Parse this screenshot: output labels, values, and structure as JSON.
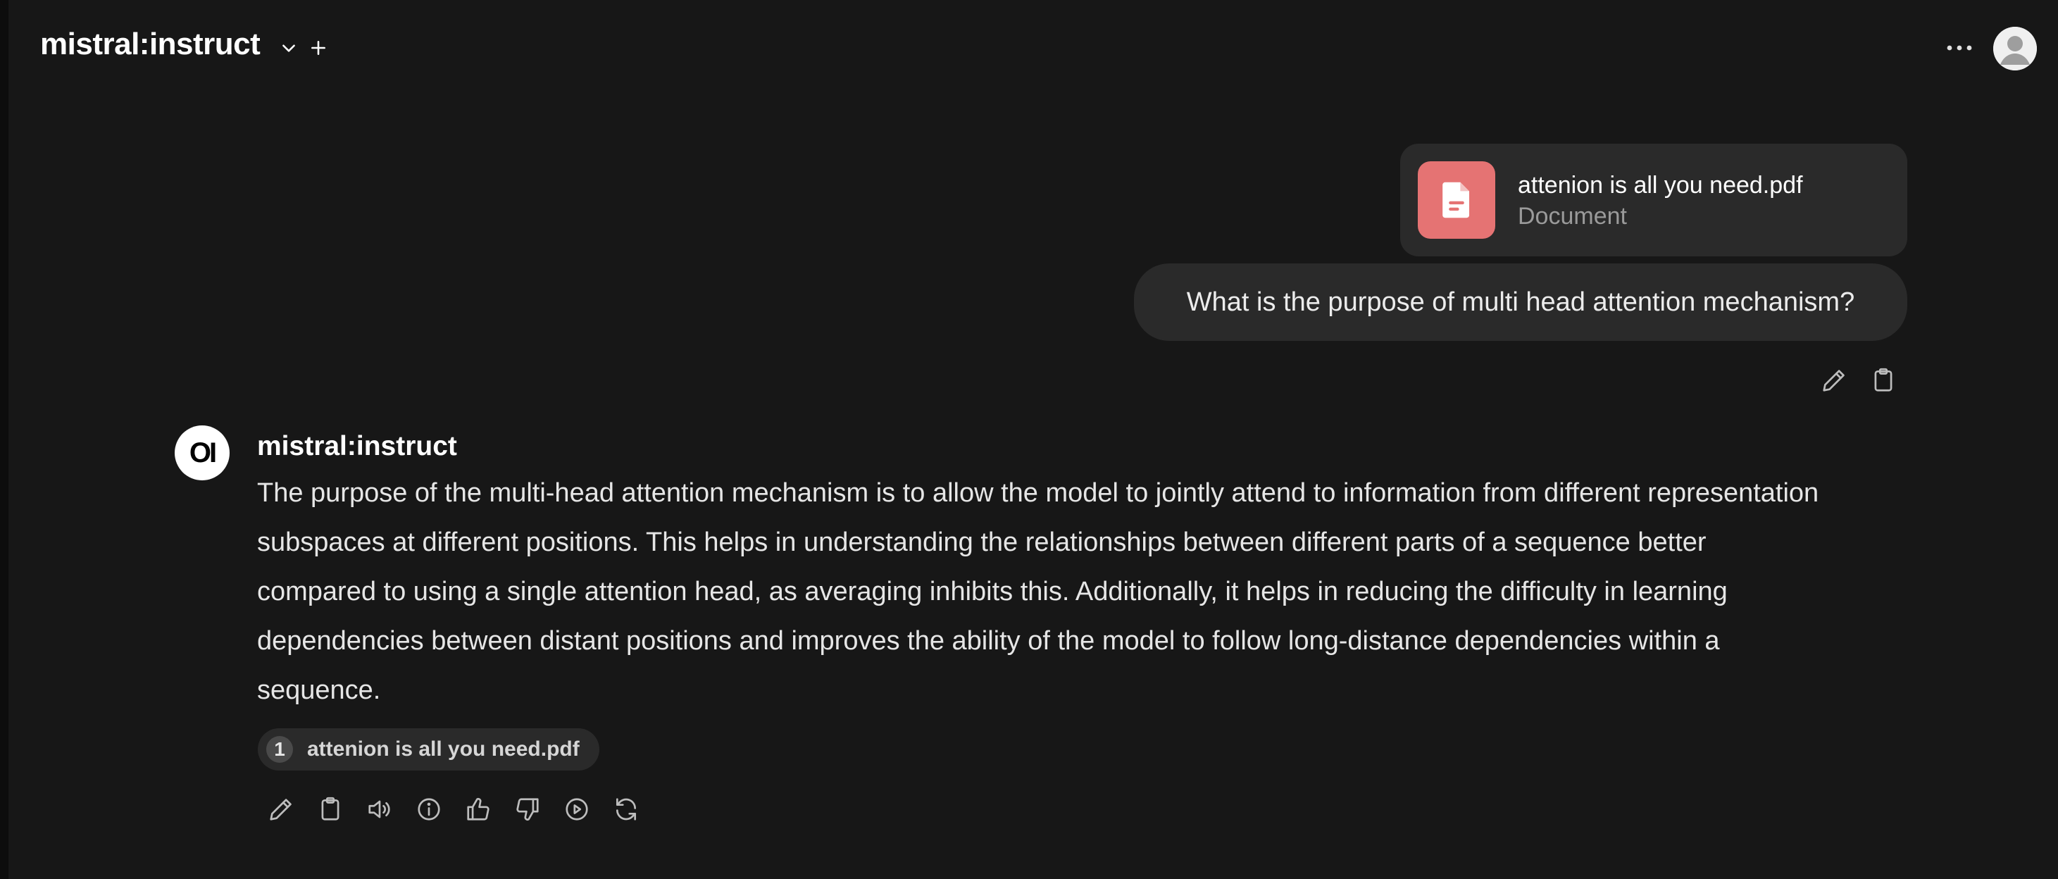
{
  "header": {
    "model_name": "mistral:instruct"
  },
  "file_attachment": {
    "name": "attenion is all you need.pdf",
    "type": "Document"
  },
  "user_message": {
    "text": "What is the purpose of multi head attention mechanism?"
  },
  "assistant": {
    "logo_text": "OI",
    "name": "mistral:instruct",
    "message_lines": [
      "The purpose of the multi-head attention mechanism is to allow the model to jointly attend to information from different representation",
      "subspaces at different positions. This helps in understanding the relationships between different parts of a sequence better",
      "compared to using a single attention head, as averaging inhibits this. Additionally, it helps in reducing the difficulty in learning",
      "dependencies between distant positions and improves the ability of the model to follow long-distance dependencies within a",
      "sequence."
    ],
    "citation": {
      "number": "1",
      "label": "attenion is all you need.pdf"
    }
  },
  "icons": {
    "header": [
      "chevron-down-icon",
      "plus-icon",
      "more-icon",
      "avatar"
    ],
    "user_actions": [
      "pencil-icon",
      "clipboard-icon"
    ],
    "assistant_actions": [
      "pencil-icon",
      "clipboard-icon",
      "speaker-icon",
      "info-icon",
      "thumbs-up-icon",
      "thumbs-down-icon",
      "play-icon",
      "regenerate-icon"
    ]
  },
  "colors": {
    "background": "#171717",
    "bubble": "#2a2a2a",
    "file_icon_bg": "#e57373"
  }
}
